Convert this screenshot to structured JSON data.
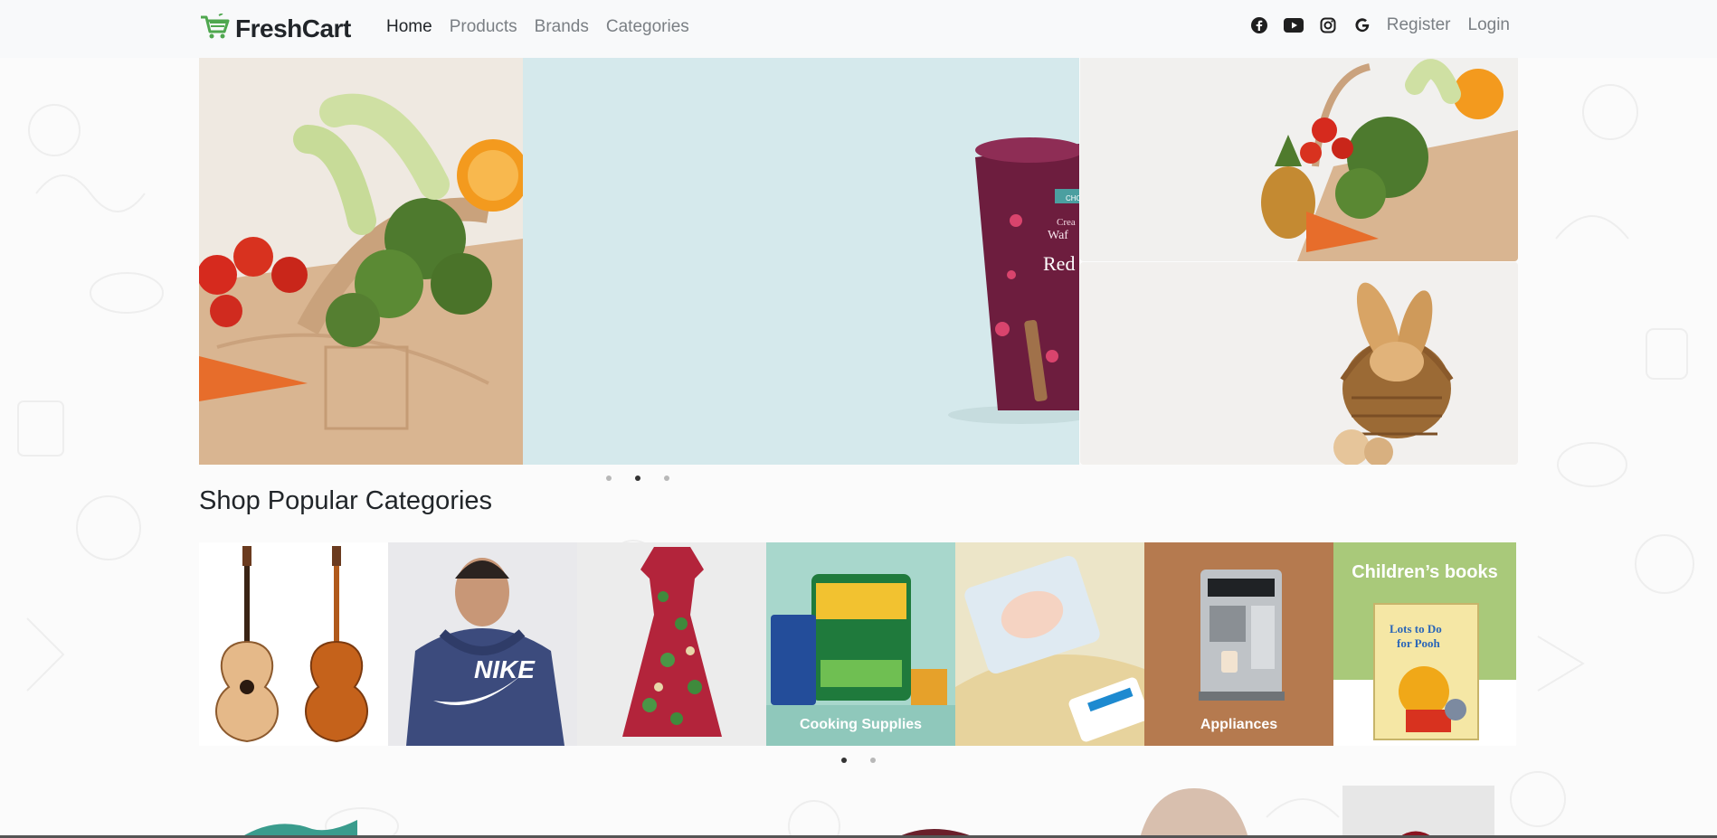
{
  "navbar": {
    "brand": "FreshCart",
    "links": [
      "Home",
      "Products",
      "Brands",
      "Categories"
    ],
    "active_link": "Home",
    "social_icons": [
      "facebook-icon",
      "youtube-icon",
      "instagram-icon",
      "google-icon"
    ],
    "register": "Register",
    "login": "Login"
  },
  "hero": {
    "slider_dots": 3,
    "active_dot": 2,
    "product_label_lines": [
      "CHO",
      "Crea",
      "Waf",
      "Red"
    ]
  },
  "categories": {
    "title": "Shop Popular Categories",
    "items": [
      {
        "name": "guitar",
        "label": ""
      },
      {
        "name": "nike-hoodie",
        "label": ""
      },
      {
        "name": "dress",
        "label": ""
      },
      {
        "name": "cooking-supplies",
        "label": "Cooking Supplies"
      },
      {
        "name": "baby-diapers",
        "label": ""
      },
      {
        "name": "appliances",
        "label": "Appliances"
      },
      {
        "name": "childrens-books",
        "label": "Children’s books"
      }
    ],
    "book_title": [
      "Lots to Do",
      "for Pooh"
    ],
    "brand_text": "NIKE",
    "pager_dots": 2,
    "active_pager_dot": 1
  },
  "colors": {
    "brand_green": "#4fa74f",
    "navbar_bg": "#f8f9fa",
    "hero_mid_bg": "#d5e9ec",
    "cooking_bg": "#a8d7cc",
    "appliances_bg": "#b57a4f",
    "books_bg": "#a9c97a"
  }
}
